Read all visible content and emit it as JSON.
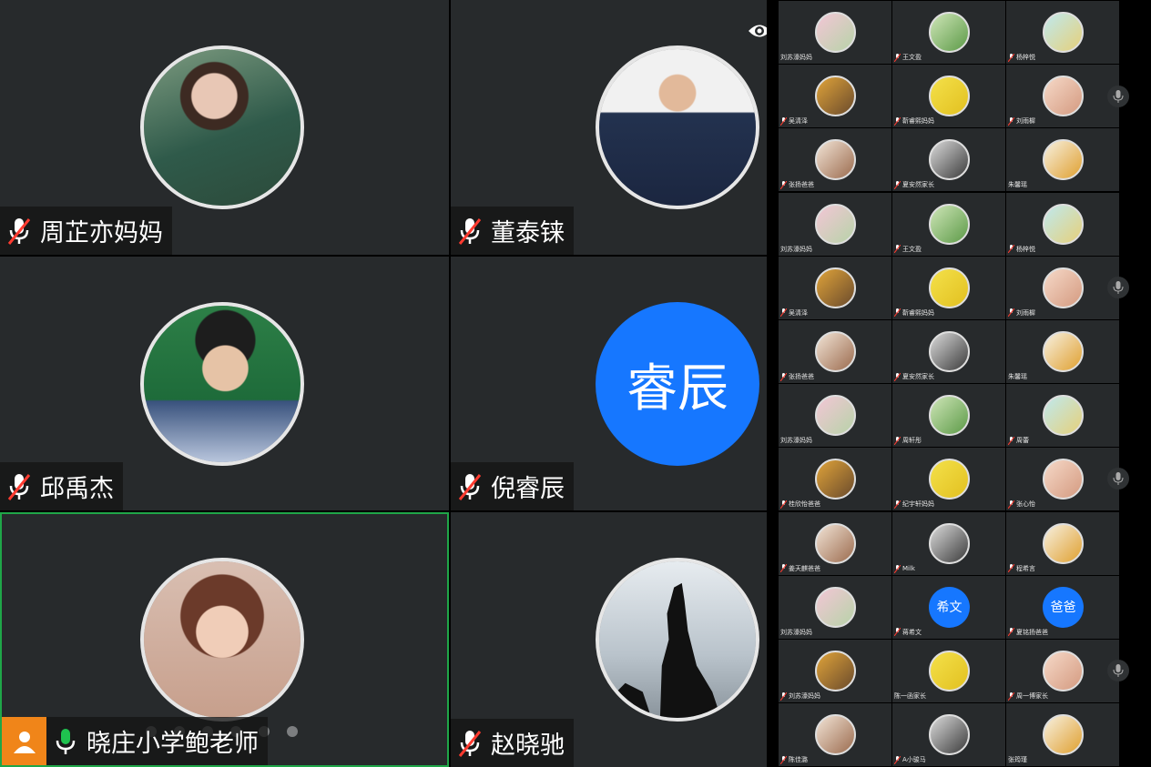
{
  "colors": {
    "tile_bg": "#272a2c",
    "active_border": "#1fa648",
    "text_avatar_bg": "#1677ff",
    "host_badge": "#f08519",
    "mic_muted_slash": "#ff3b30"
  },
  "main_participants": [
    {
      "name": "周芷亦妈妈",
      "mic": "muted",
      "avatar": "photo"
    },
    {
      "name": "董泰铼",
      "mic": "muted",
      "avatar": "photo"
    },
    {
      "name": "邱禹杰",
      "mic": "muted",
      "avatar": "photo"
    },
    {
      "name": "倪睿辰",
      "mic": "muted",
      "avatar_text": "睿辰"
    },
    {
      "name": "晓庄小学鲍老师",
      "mic": "on",
      "avatar": "photo",
      "active": true,
      "host": true
    },
    {
      "name": "赵晓驰",
      "mic": "muted",
      "avatar": "photo"
    }
  ],
  "icons": {
    "eye": "eye-icon",
    "host": "person-icon",
    "mic_muted": "mic-muted-icon",
    "mic_on": "mic-icon"
  },
  "main_page_dots": 6,
  "side_grid": [
    [
      "刘苏濠妈妈",
      "王文盈",
      "杨梓悦"
    ],
    [
      "吴清泽",
      "靳睿熙妈妈",
      "刘雨樨"
    ],
    [
      "张扬爸爸",
      "夏安然家长",
      "朱馨瑶"
    ],
    [
      "刘苏濠妈妈",
      "王文盈",
      "杨梓悦"
    ],
    [
      "吴清泽",
      "靳睿熙妈妈",
      "刘雨樨"
    ],
    [
      "张扬爸爸",
      "夏安然家长",
      "朱馨瑶"
    ],
    [
      "刘苏濠妈妈",
      "周轩彤",
      "周蕾"
    ],
    [
      "桂欣怡爸爸",
      "纪宇轩妈妈",
      "张心怡"
    ],
    [
      "姜天麒爸爸",
      "Milk",
      "程希言"
    ],
    [
      "刘苏濠妈妈",
      "蒋希文",
      "夏铭扬爸爸"
    ],
    [
      "刘苏濠妈妈",
      "陈一函家长",
      "周一博家长"
    ],
    [
      "陈佳潞",
      "A小骏马",
      "张筠瑾"
    ]
  ],
  "side_text_avatars": {
    "9-1": "希文",
    "9-2": "爸爸"
  }
}
